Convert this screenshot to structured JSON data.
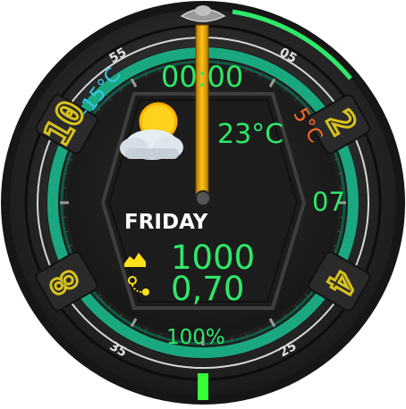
{
  "watch": {
    "time": "00:00",
    "weather": {
      "current_temp": "23°C",
      "min_temp": "-15°C",
      "max_temp": "5°C",
      "icon": "sun-behind-cloud-icon"
    },
    "date": {
      "weekday": "FRIDAY",
      "day": "07"
    },
    "activity": {
      "steps": "1000",
      "distance": "0,70",
      "step_icon": "sneaker-icon",
      "distance_icon": "route-pin-icon"
    },
    "battery": {
      "level": "100%"
    },
    "bezel": {
      "outer_labels": [
        "05",
        "25",
        "35",
        "55"
      ],
      "hour_numerals": [
        "2",
        "4",
        "8",
        "10"
      ]
    }
  },
  "colors": {
    "accent_green": "#2ee86a",
    "cold_blue": "#38c8ee",
    "hot_orange": "#ff6a2a",
    "numeral_yellow": "#d8c21c",
    "teal_ring": "#1aa880"
  }
}
